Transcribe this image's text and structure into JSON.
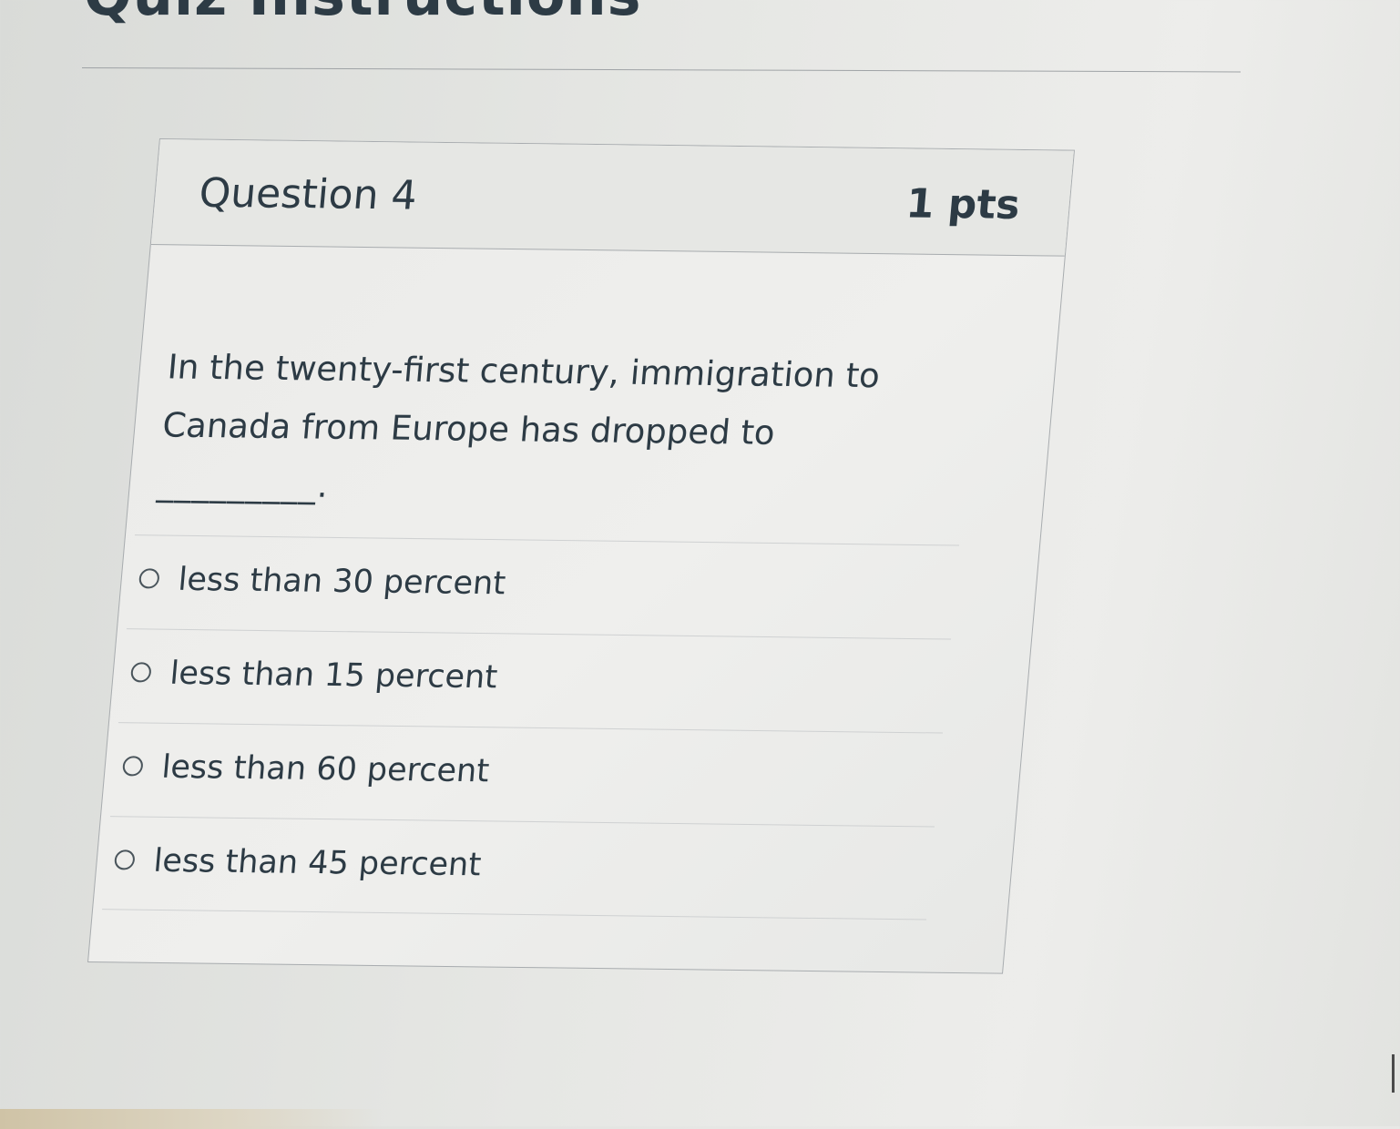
{
  "page": {
    "heading": "Quiz Instructions"
  },
  "question": {
    "title": "Question 4",
    "points": "1 pts",
    "text": "In the twenty-first century, immigration to Canada from Europe has dropped to",
    "blank": "_________."
  },
  "answers": [
    {
      "label": "less than 30 percent",
      "selected": false
    },
    {
      "label": "less than 15 percent",
      "selected": false
    },
    {
      "label": "less than 60 percent",
      "selected": false
    },
    {
      "label": "less than 45 percent",
      "selected": false
    }
  ],
  "colors": {
    "text": "#2d3b45",
    "border": "#a8acaf",
    "header_background": "#e6e7e4"
  }
}
